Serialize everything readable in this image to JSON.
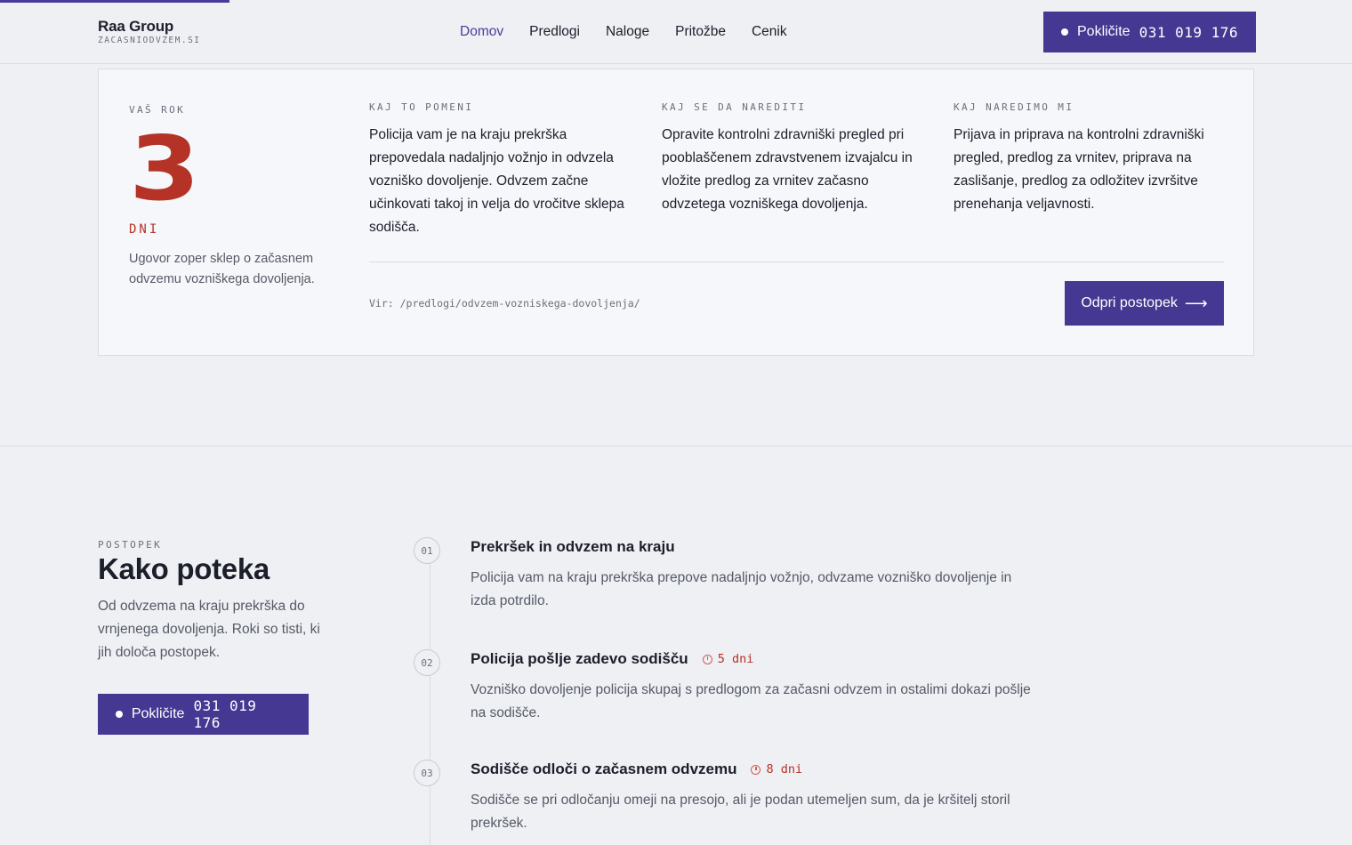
{
  "header": {
    "brand_name": "Raa Group",
    "brand_domain": "ZACASNIODVZEM.SI",
    "nav": [
      {
        "label": "Domov",
        "active": true
      },
      {
        "label": "Predlogi",
        "active": false
      },
      {
        "label": "Naloge",
        "active": false
      },
      {
        "label": "Pritožbe",
        "active": false
      },
      {
        "label": "Cenik",
        "active": false
      }
    ],
    "call_label": "Pokličite",
    "call_number": "031 019 176"
  },
  "card": {
    "deadline_eyebrow": "VAŠ ROK",
    "deadline_value": "3",
    "deadline_unit": "DNI",
    "deadline_desc": "Ugovor zoper sklep o začasnem odvzemu vozniškega dovoljenja.",
    "columns": [
      {
        "eyebrow": "KAJ TO POMENI",
        "text": "Policija vam je na kraju prekrška prepovedala nadaljnjo vožnjo in odvzela vozniško dovoljenje. Odvzem začne učinkovati takoj in velja do vročitve sklepa sodišča."
      },
      {
        "eyebrow": "KAJ SE DA NAREDITI",
        "text": "Opravite kontrolni zdravniški pregled pri pooblaščenem zdravstvenem izvajalcu in vložite predlog za vrnitev začasno odvzetega vozniškega dovoljenja."
      },
      {
        "eyebrow": "KAJ NAREDIMO MI",
        "text": "Prijava in priprava na kontrolni zdravniški pregled, predlog za vrnitev, priprava na zaslišanje, predlog za odložitev izvršitve prenehanja veljavnosti."
      }
    ],
    "source": "Vir: /predlogi/odvzem-vozniskega-dovoljenja/",
    "open_label": "Odpri postopek",
    "open_arrow": "⟶"
  },
  "process": {
    "eyebrow": "POSTOPEK",
    "title": "Kako poteka",
    "desc": "Od odvzema na kraju prekrška do vrnjenega dovoljenja. Roki so tisti, ki jih določa postopek.",
    "call_label": "Pokličite",
    "call_number": "031 019 176",
    "steps": [
      {
        "num": "01",
        "title": "Prekršek in odvzem na kraju",
        "tag": "",
        "body": "Policija vam na kraju prekrška prepove nadaljnjo vožnjo, odvzame vozniško dovoljenje in izda potrdilo."
      },
      {
        "num": "02",
        "title": "Policija pošlje zadevo sodišču",
        "tag": "5 dni",
        "body": "Vozniško dovoljenje policija skupaj s predlogom za začasni odvzem in ostalimi dokazi pošlje na sodišče."
      },
      {
        "num": "03",
        "title": "Sodišče odloči o začasnem odvzemu",
        "tag": "8 dni",
        "body": "Sodišče se pri odločanju omeji na presojo, ali je podan utemeljen sum, da je kršitelj storil prekršek."
      }
    ]
  },
  "colors": {
    "accent": "#453892",
    "deadline_red": "#b53226"
  }
}
